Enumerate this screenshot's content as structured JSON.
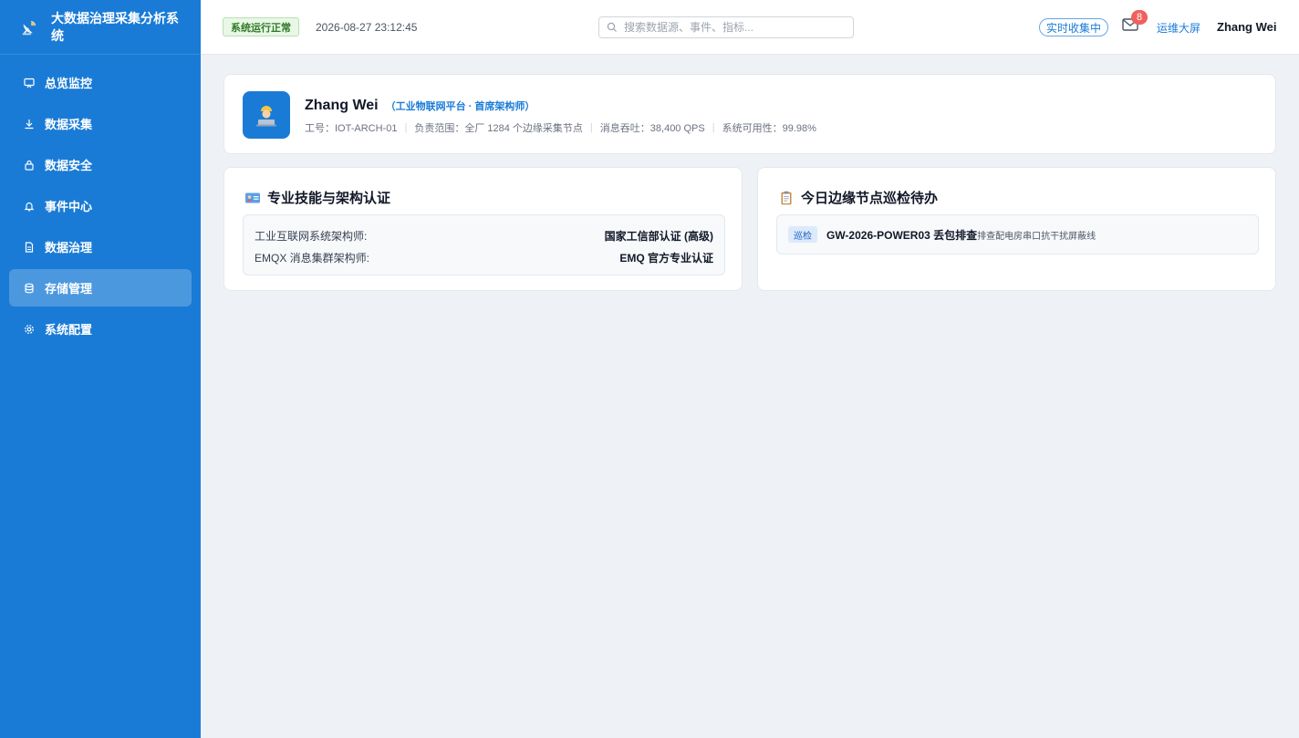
{
  "app": {
    "title": "大数据治理采集分析系统"
  },
  "sidebar": {
    "items": [
      {
        "label": "总览监控",
        "icon": "monitor-icon",
        "active": false
      },
      {
        "label": "数据采集",
        "icon": "download-icon",
        "active": false
      },
      {
        "label": "数据安全",
        "icon": "lock-icon",
        "active": false
      },
      {
        "label": "事件中心",
        "icon": "bell-icon",
        "active": false
      },
      {
        "label": "数据治理",
        "icon": "document-icon",
        "active": false
      },
      {
        "label": "存储管理",
        "icon": "database-icon",
        "active": true
      },
      {
        "label": "系统配置",
        "icon": "gear-icon",
        "active": false
      }
    ]
  },
  "header": {
    "status": "系统运行正常",
    "datetime": "2026-08-27 23:12:45",
    "search_placeholder": "搜索数据源、事件、指标...",
    "realtime": "实时收集中",
    "mail_count": "8",
    "bigscreen": "运维大屏",
    "username": "Zhang Wei"
  },
  "profile": {
    "name": "Zhang Wei",
    "role": "（工业物联网平台 · 首席架构师）",
    "meta": [
      "工号：IOT-ARCH-01",
      "负责范围：全厂 1284 个边缘采集节点",
      "消息吞吐：38,400 QPS",
      "系统可用性：99.98%"
    ]
  },
  "skills": {
    "title": "专业技能与架构认证",
    "rows": [
      {
        "key": "工业互联网系统架构师:",
        "value": "国家工信部认证 (高级)"
      },
      {
        "key": "EMQX 消息集群架构师:",
        "value": "EMQ 官方专业认证"
      }
    ]
  },
  "todo": {
    "title": "今日边缘节点巡检待办",
    "items": [
      {
        "tag": "巡检",
        "title": "GW-2026-POWER03 丢包排查",
        "desc": "排查配电房串口抗干扰屏蔽线"
      }
    ]
  },
  "colors": {
    "primary": "#1a7bd6",
    "success": "#2f7a27",
    "badge": "#f0615d"
  }
}
